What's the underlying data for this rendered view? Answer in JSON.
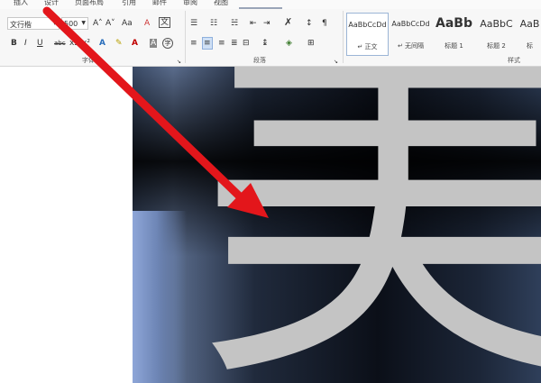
{
  "tabs": [
    "插入",
    "设计",
    "页面布局",
    "引用",
    "邮件",
    "审阅",
    "视图"
  ],
  "font": {
    "name": "文行楷",
    "size": "500",
    "grow_icon": "A˄",
    "shrink_icon": "A˅",
    "case_icon": "Aa",
    "clear_icon": "A",
    "bold": "B",
    "italic": "I",
    "underline": "U",
    "strike": "abc",
    "subscript": "x₂",
    "superscript": "x²",
    "group_label": "字体"
  },
  "paragraph": {
    "group_label": "段落"
  },
  "styles": {
    "items": [
      {
        "sample": "AaBbCcDd",
        "name": "↵ 正文"
      },
      {
        "sample": "AaBbCcDd",
        "name": "↵ 无间隔"
      },
      {
        "sample": "AaBb",
        "name": "标题 1"
      },
      {
        "sample": "AaBbC",
        "name": "标题 2"
      },
      {
        "sample": "AaB",
        "name": "标"
      }
    ],
    "group_label": "样式"
  },
  "document": {
    "character": "美"
  },
  "colors": {
    "annotation_arrow": "#e3161b",
    "char_fill": "#c4c4c4"
  },
  "icons": [
    "bullets-icon",
    "numbering-icon",
    "multilevel-list-icon",
    "decrease-indent-icon",
    "increase-indent-icon",
    "chinese-layout-icon",
    "sort-icon",
    "show-marks-icon",
    "align-left-icon",
    "align-center-icon",
    "align-right-icon",
    "justify-icon",
    "distributed-icon",
    "line-spacing-icon",
    "shading-icon",
    "borders-icon",
    "text-effects-icon",
    "highlight-icon",
    "font-color-icon",
    "char-shading-icon",
    "enclose-char-icon"
  ]
}
